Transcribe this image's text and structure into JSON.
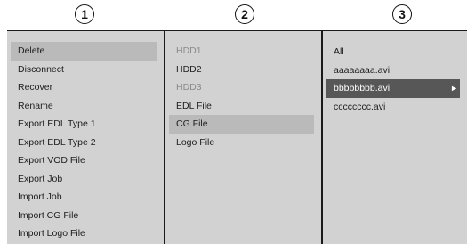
{
  "steps": [
    "1",
    "2",
    "3"
  ],
  "panel1": {
    "items": [
      {
        "label": "Delete",
        "state": "selected"
      },
      {
        "label": "Disconnect"
      },
      {
        "label": "Recover"
      },
      {
        "label": "Rename"
      },
      {
        "label": "Export EDL Type 1"
      },
      {
        "label": "Export EDL Type 2"
      },
      {
        "label": "Export VOD File"
      },
      {
        "label": "Export Job"
      },
      {
        "label": "Import Job"
      },
      {
        "label": "Import CG File"
      },
      {
        "label": "Import Logo File"
      }
    ]
  },
  "panel2": {
    "items": [
      {
        "label": "HDD1",
        "state": "disabled"
      },
      {
        "label": "HDD2"
      },
      {
        "label": "HDD3",
        "state": "disabled"
      },
      {
        "label": "EDL File"
      },
      {
        "label": "CG File",
        "state": "selected"
      },
      {
        "label": "Logo File"
      }
    ]
  },
  "panel3": {
    "items": [
      {
        "label": "All",
        "state": "header"
      },
      {
        "label": "aaaaaaaa.avi"
      },
      {
        "label": "bbbbbbbb.avi",
        "state": "active",
        "icon": "arrow-right-icon"
      },
      {
        "label": "cccccccc.avi"
      }
    ]
  },
  "colors": {
    "panel_bg": "#d2d2d2",
    "selected_bg": "#bababa",
    "active_bg": "#575757",
    "disabled_text": "#8a8a8a"
  }
}
